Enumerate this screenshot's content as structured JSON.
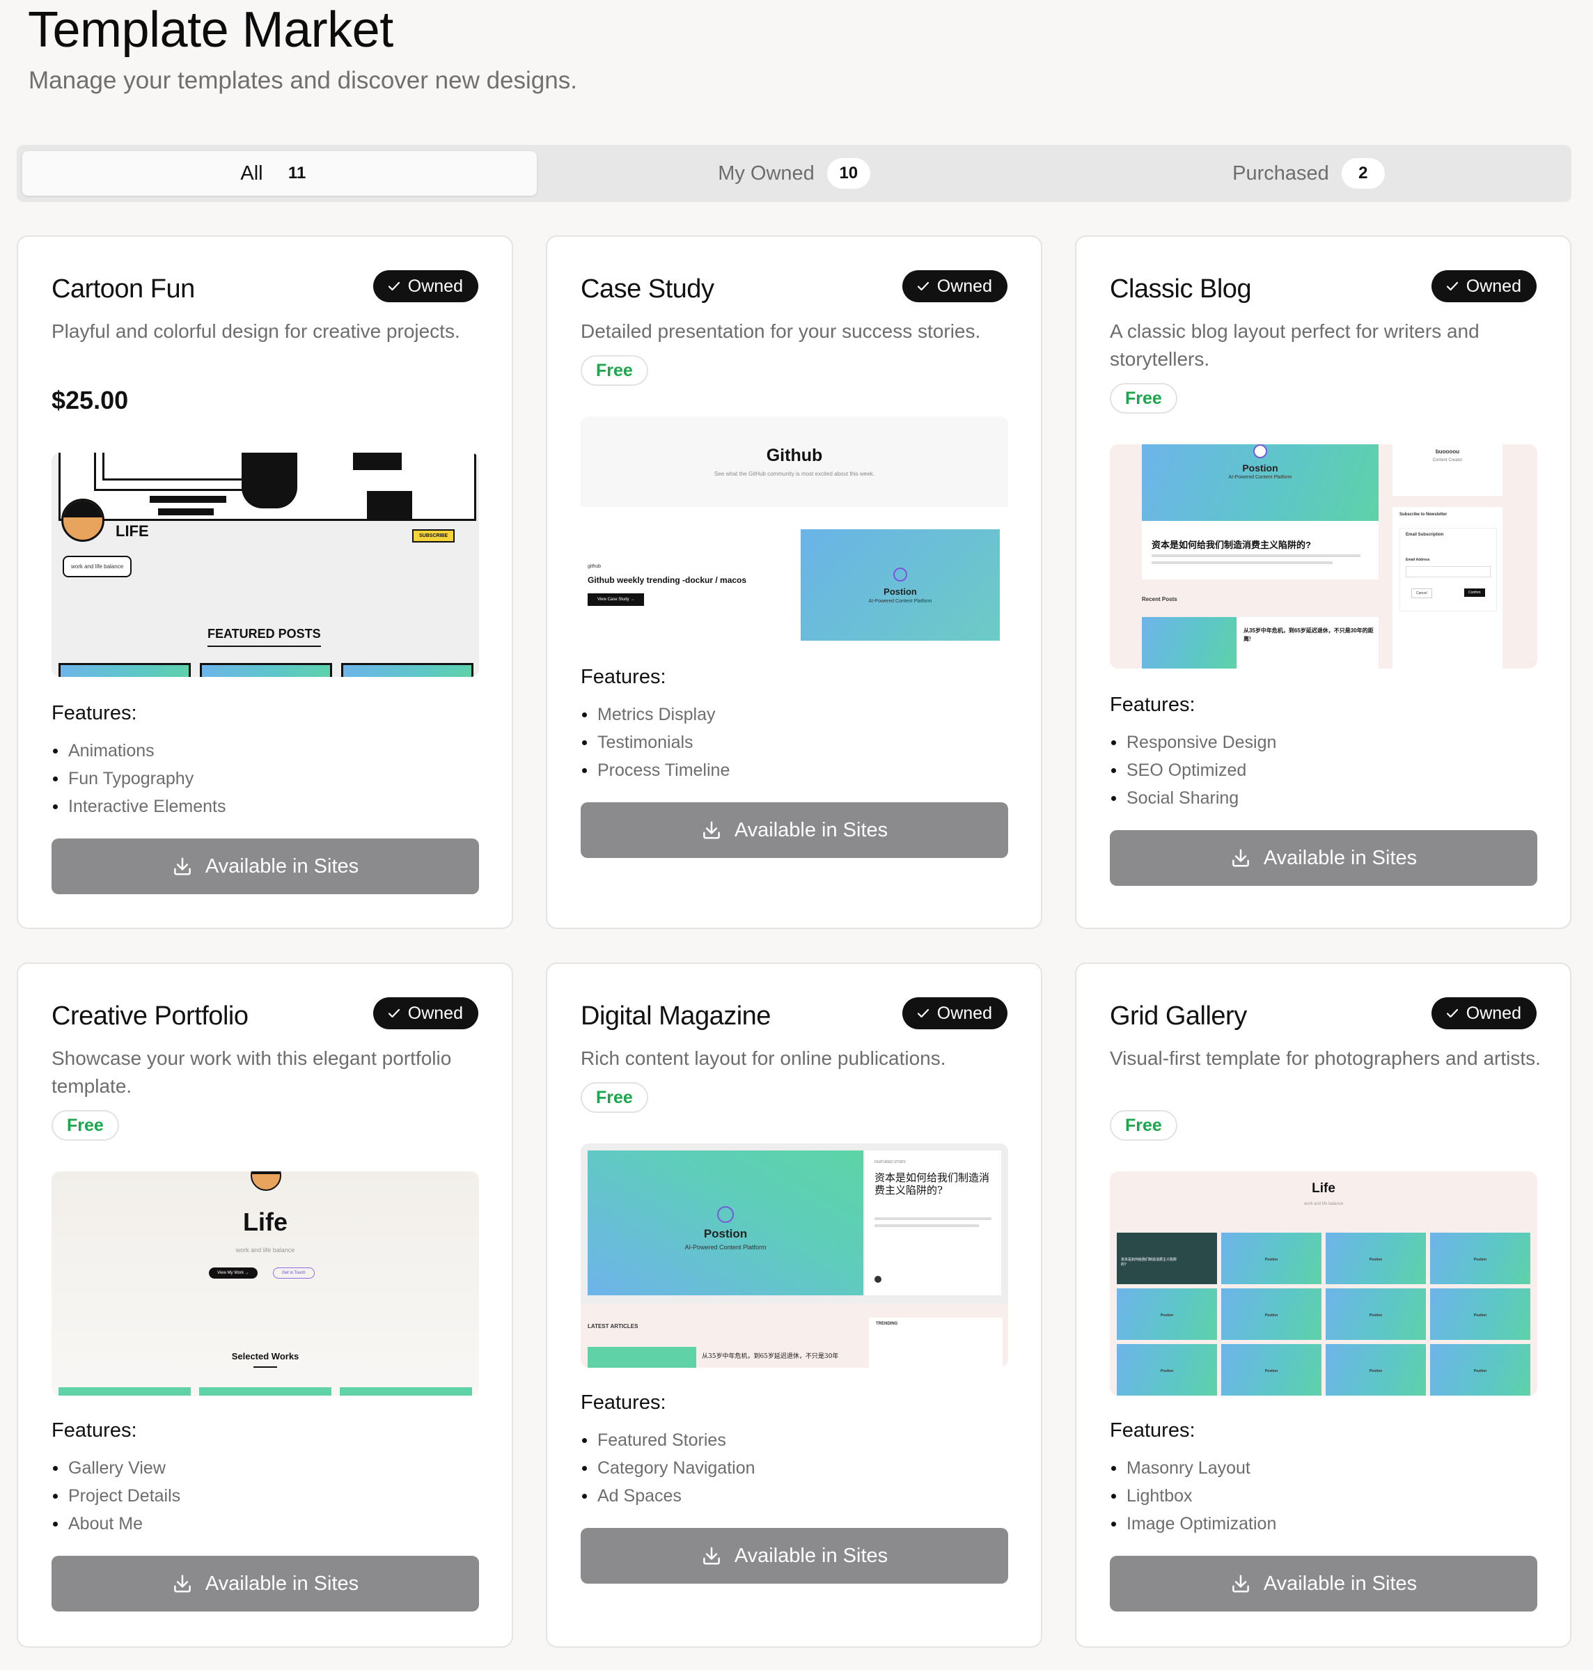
{
  "header": {
    "title": "Template Market",
    "subtitle": "Manage your templates and discover new designs."
  },
  "tabs": [
    {
      "label": "All",
      "count": "11"
    },
    {
      "label": "My Owned",
      "count": "10"
    },
    {
      "label": "Purchased",
      "count": "2"
    }
  ],
  "common": {
    "owned_label": "Owned",
    "free_label": "Free",
    "features_label": "Features:",
    "action_label": "Available in Sites"
  },
  "cards": [
    {
      "title": "Cartoon Fun",
      "description": "Playful and colorful design for creative projects.",
      "price": "$25.00",
      "features": [
        "Animations",
        "Fun Typography",
        "Interactive Elements"
      ],
      "preview": {
        "brand": "LIFE",
        "tagline": "work and life balance",
        "subscribe": "SUBSCRIBE",
        "section": "FEATURED POSTS"
      }
    },
    {
      "title": "Case Study",
      "description": "Detailed presentation for your success stories.",
      "features": [
        "Metrics Display",
        "Testimonials",
        "Process Timeline"
      ],
      "preview": {
        "heading": "Github",
        "sub": "See what the GitHub community is most excited about this week.",
        "tag": "github",
        "post_title": "Github weekly trending -dockur / macos",
        "button": "View Case Study →",
        "brand": "Postion",
        "brand_sub": "AI-Powered Content Platform"
      }
    },
    {
      "title": "Classic Blog",
      "description": "A classic blog layout perfect for writers and storytellers.",
      "features": [
        "Responsive Design",
        "SEO Optimized",
        "Social Sharing"
      ],
      "preview": {
        "brand": "Postion",
        "brand_sub": "AI-Powered Content Platform",
        "article": "资本是如何给我们制造消费主义陷阱的?",
        "recent": "Recent Posts",
        "article2": "从35岁中年危机，到65岁延迟退休，不只是30年的距离!",
        "side_name": "buoooou",
        "side_role": "Content Creator",
        "newsletter": "Subscribe to Newsletter",
        "email_sub": "Email Subscription",
        "email_label": "Email Address",
        "cancel": "Cancel",
        "confirm": "Confirm"
      }
    },
    {
      "title": "Creative Portfolio",
      "description": "Showcase your work with this elegant portfolio template.",
      "features": [
        "Gallery View",
        "Project Details",
        "About Me"
      ],
      "preview": {
        "heading": "Life",
        "sub": "work and life balance",
        "btn1": "View My Work →",
        "btn2": "Get in Touch",
        "section": "Selected Works"
      }
    },
    {
      "title": "Digital Magazine",
      "description": "Rich content layout for online publications.",
      "features": [
        "Featured Stories",
        "Category Navigation",
        "Ad Spaces"
      ],
      "preview": {
        "brand": "Postion",
        "brand_sub": "AI-Powered Content Platform",
        "featured": "FEATURED STORY",
        "article": "资本是如何给我们制造消费主义陷阱的?",
        "latest": "LATEST ARTICLES",
        "trending": "TRENDING",
        "article2": "从35岁中年危机，到65岁延迟退休，不只是30年"
      }
    },
    {
      "title": "Grid Gallery",
      "description": "Visual-first template for photographers and artists.",
      "features": [
        "Masonry Layout",
        "Lightbox",
        "Image Optimization"
      ],
      "preview": {
        "heading": "Life",
        "sub": "work and life balance",
        "tile": "Postion",
        "dark_tile": "资本是如何给我们制造消费主义陷阱的?"
      }
    }
  ]
}
